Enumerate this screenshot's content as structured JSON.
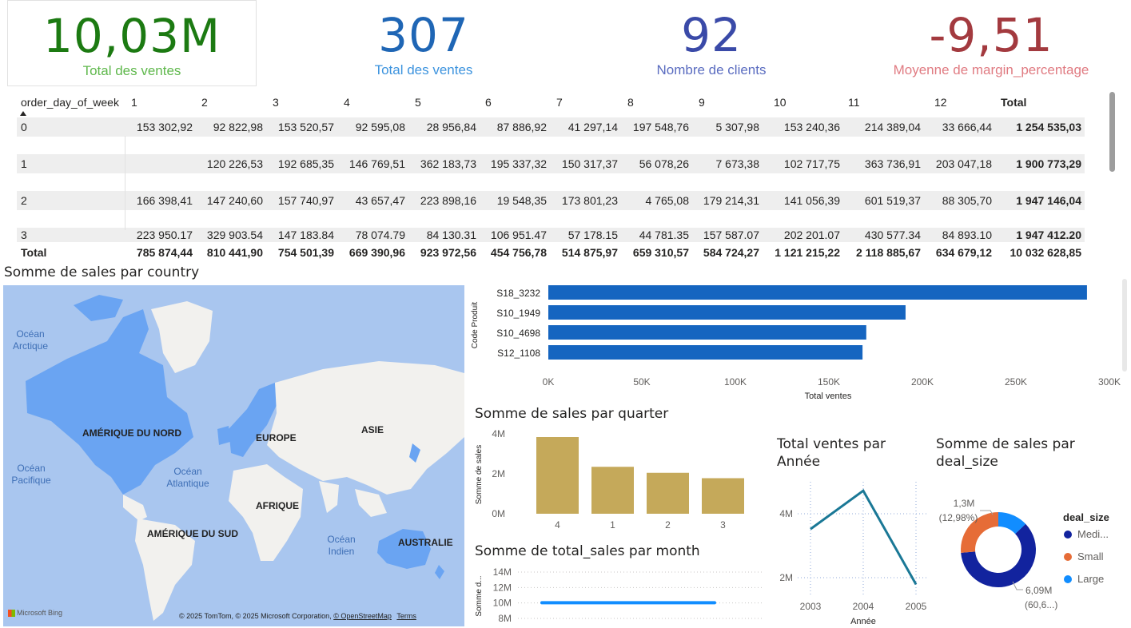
{
  "kpis": [
    {
      "value": "10,03M",
      "label": "Total des ventes",
      "color": "#1c7a12",
      "label_color": "#5fb84c"
    },
    {
      "value": "307",
      "label": "Total des ventes",
      "color": "#1f66b5",
      "label_color": "#3c93de"
    },
    {
      "value": "92",
      "label": "Nombre de clients",
      "color": "#3a4aa8",
      "label_color": "#5a6cc0"
    },
    {
      "value": "-9,51",
      "label": "Moyenne de margin_percentage",
      "color": "#a33a3f",
      "label_color": "#e07b82"
    }
  ],
  "matrix": {
    "corner_header": "order_day_of_week",
    "columns": [
      "1",
      "2",
      "3",
      "4",
      "5",
      "6",
      "7",
      "8",
      "9",
      "10",
      "11",
      "12",
      "Total"
    ],
    "rows": [
      {
        "label": "0",
        "cells": [
          "153 302,92",
          "92 822,98",
          "153 520,57",
          "92 595,08",
          "28 956,84",
          "87 886,92",
          "41 297,14",
          "197 548,76",
          "5 307,98",
          "153 240,36",
          "214 389,04",
          "33 666,44",
          "1 254 535,03"
        ]
      },
      {
        "label": "1",
        "cells": [
          "",
          "120 226,53",
          "192 685,35",
          "146 769,51",
          "362 183,73",
          "195 337,32",
          "150 317,37",
          "56 078,26",
          "7 673,38",
          "102 717,75",
          "363 736,91",
          "203 047,18",
          "1 900 773,29"
        ]
      },
      {
        "label": "2",
        "cells": [
          "166 398,41",
          "147 240,60",
          "157 740,97",
          "43 657,47",
          "223 898,16",
          "19 548,35",
          "173 801,23",
          "4 765,08",
          "179 214,31",
          "141 056,39",
          "601 519,37",
          "88 305,70",
          "1 947 146,04"
        ]
      },
      {
        "label": "3",
        "cells": [
          "223 950.17",
          "329 903.54",
          "147 183.84",
          "78 074.79",
          "84 130.31",
          "106 951.47",
          "57 178.15",
          "44 781.35",
          "157 587.07",
          "202 201.07",
          "430 577.34",
          "84 893.10",
          "1 947 412.20"
        ]
      }
    ],
    "total_label": "Total",
    "totals": [
      "785 874,44",
      "810 441,90",
      "754 501,39",
      "669 390,96",
      "923 972,56",
      "454 756,78",
      "514 875,97",
      "659 310,57",
      "584 724,27",
      "1 121 215,22",
      "2 118 885,67",
      "634 679,12",
      "10 032 628,85"
    ]
  },
  "map": {
    "title": "Somme de sales par country",
    "continents": [
      "AMÉRIQUE DU NORD",
      "EUROPE",
      "ASIE",
      "AFRIQUE",
      "AMÉRIQUE DU SUD",
      "AUSTRALIE"
    ],
    "oceans": [
      "Océan Arctique",
      "Océan Pacifique",
      "Océan Atlantique",
      "Océan Indien"
    ],
    "logo": "Microsoft Bing",
    "attribution": "© 2025 TomTom, © 2025 Microsoft Corporation,",
    "osm_link": "© OpenStreetMap",
    "terms_link": "Terms"
  },
  "chart_data": [
    {
      "type": "bar",
      "orientation": "horizontal",
      "title": "",
      "categories": [
        "S18_3232",
        "S10_1949",
        "S10_4698",
        "S12_1108"
      ],
      "values": [
        288000,
        191000,
        170000,
        168000
      ],
      "xlabel": "Total ventes",
      "ylabel": "Code Produit",
      "xlim": [
        0,
        300000
      ],
      "ticks": [
        "0K",
        "50K",
        "100K",
        "150K",
        "200K",
        "250K",
        "300K"
      ],
      "color": "#1565c0"
    },
    {
      "type": "bar",
      "title": "Somme de sales par quarter",
      "categories": [
        "4",
        "1",
        "2",
        "3"
      ],
      "values": [
        3840000,
        2350000,
        2050000,
        1780000
      ],
      "ylabel": "Somme de sales",
      "ylim": [
        0,
        4000000
      ],
      "ticks": [
        "0M",
        "2M",
        "4M"
      ],
      "color": "#c5a95a"
    },
    {
      "type": "line",
      "title": "Somme de total_sales par month",
      "ylabel": "Somme d...",
      "ticks": [
        "8M",
        "10M",
        "12M",
        "14M"
      ],
      "ylim": [
        8000000,
        14000000
      ],
      "values": [
        10030000,
        10030000
      ],
      "color": "#118dff"
    },
    {
      "type": "line",
      "title": "Total ventes par Année",
      "x": [
        "2003",
        "2004",
        "2005"
      ],
      "values": [
        3520000,
        4720000,
        1790000
      ],
      "xlabel": "Année",
      "ticks": [
        "2M",
        "4M"
      ],
      "ylim": [
        1500000,
        5000000
      ],
      "color": "#1a7896"
    },
    {
      "type": "pie",
      "title": "Somme de sales par deal_size",
      "legend_title": "deal_size",
      "series": [
        {
          "name": "Medi...",
          "value": 6090000,
          "color": "#12239e"
        },
        {
          "name": "Small",
          "value": 2640000,
          "color": "#e66c37"
        },
        {
          "name": "Large",
          "value": 1300000,
          "color": "#118dff"
        }
      ],
      "labels": [
        {
          "value": "1,3M",
          "pct": "(12,98%)"
        },
        {
          "value": "6,09M",
          "pct": "(60,6...)"
        }
      ]
    }
  ]
}
